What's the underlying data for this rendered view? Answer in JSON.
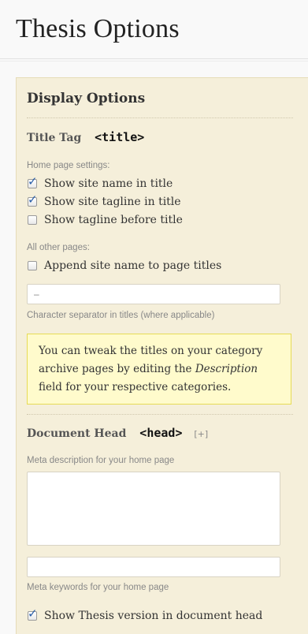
{
  "page": {
    "title": "Thesis Options"
  },
  "panel": {
    "title": "Display Options",
    "title_tag": {
      "label": "Title Tag",
      "code": "<title>",
      "home_label": "Home page settings:",
      "home_options": [
        {
          "label": "Show site name in title",
          "checked": true
        },
        {
          "label": "Show site tagline in title",
          "checked": true
        },
        {
          "label": "Show tagline before title",
          "checked": false
        }
      ],
      "other_label": "All other pages:",
      "other_options": [
        {
          "label": "Append site name to page titles",
          "checked": false
        }
      ],
      "separator_value": "–",
      "separator_caption": "Character separator in titles (where applicable)",
      "note_before": "You can tweak the titles on your category archive pages by editing the ",
      "note_emph": "Description",
      "note_after": " field for your respective categories."
    },
    "document_head": {
      "label": "Document Head",
      "code": "<head>",
      "expander": "[+]",
      "meta_description_label": "Meta description for your home page",
      "meta_description_value": "",
      "meta_keywords_value": "",
      "meta_keywords_label": "Meta keywords for your home page",
      "version_option": {
        "label": "Show Thesis version in document head",
        "checked": true
      }
    }
  },
  "colors": {
    "panel_bg": "#f5efda",
    "note_bg": "#fffbcc",
    "check": "#2b5fa8"
  }
}
